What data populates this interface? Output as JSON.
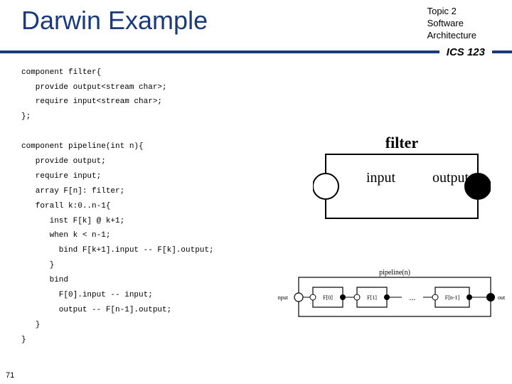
{
  "header": {
    "title": "Darwin Example",
    "topic_line1": "Topic 2",
    "topic_line2": "Software",
    "topic_line3": "Architecture",
    "course": "ICS 123"
  },
  "code": "component filter{\n   provide output<stream char>;\n   require input<stream char>;\n};\n\ncomponent pipeline(int n){\n   provide output;\n   require input;\n   array F[n]: filter;\n   forall k:0..n-1{\n      inst F[k] @ k+1;\n      when k < n-1;\n        bind F[k+1].input -- F[k].output;\n      }\n      bind\n        F[0].input -- input;\n        output -- F[n-1].output;\n   }\n}",
  "slide_number": "71",
  "filter_diagram": {
    "title": "filter",
    "left_label": "input",
    "right_label": "output"
  },
  "pipeline_diagram": {
    "title": "pipeline(n)",
    "input": "input",
    "output": "output",
    "boxes": [
      "F[0]",
      "F[1]",
      "F[n-1]"
    ],
    "ellipsis": "..."
  }
}
